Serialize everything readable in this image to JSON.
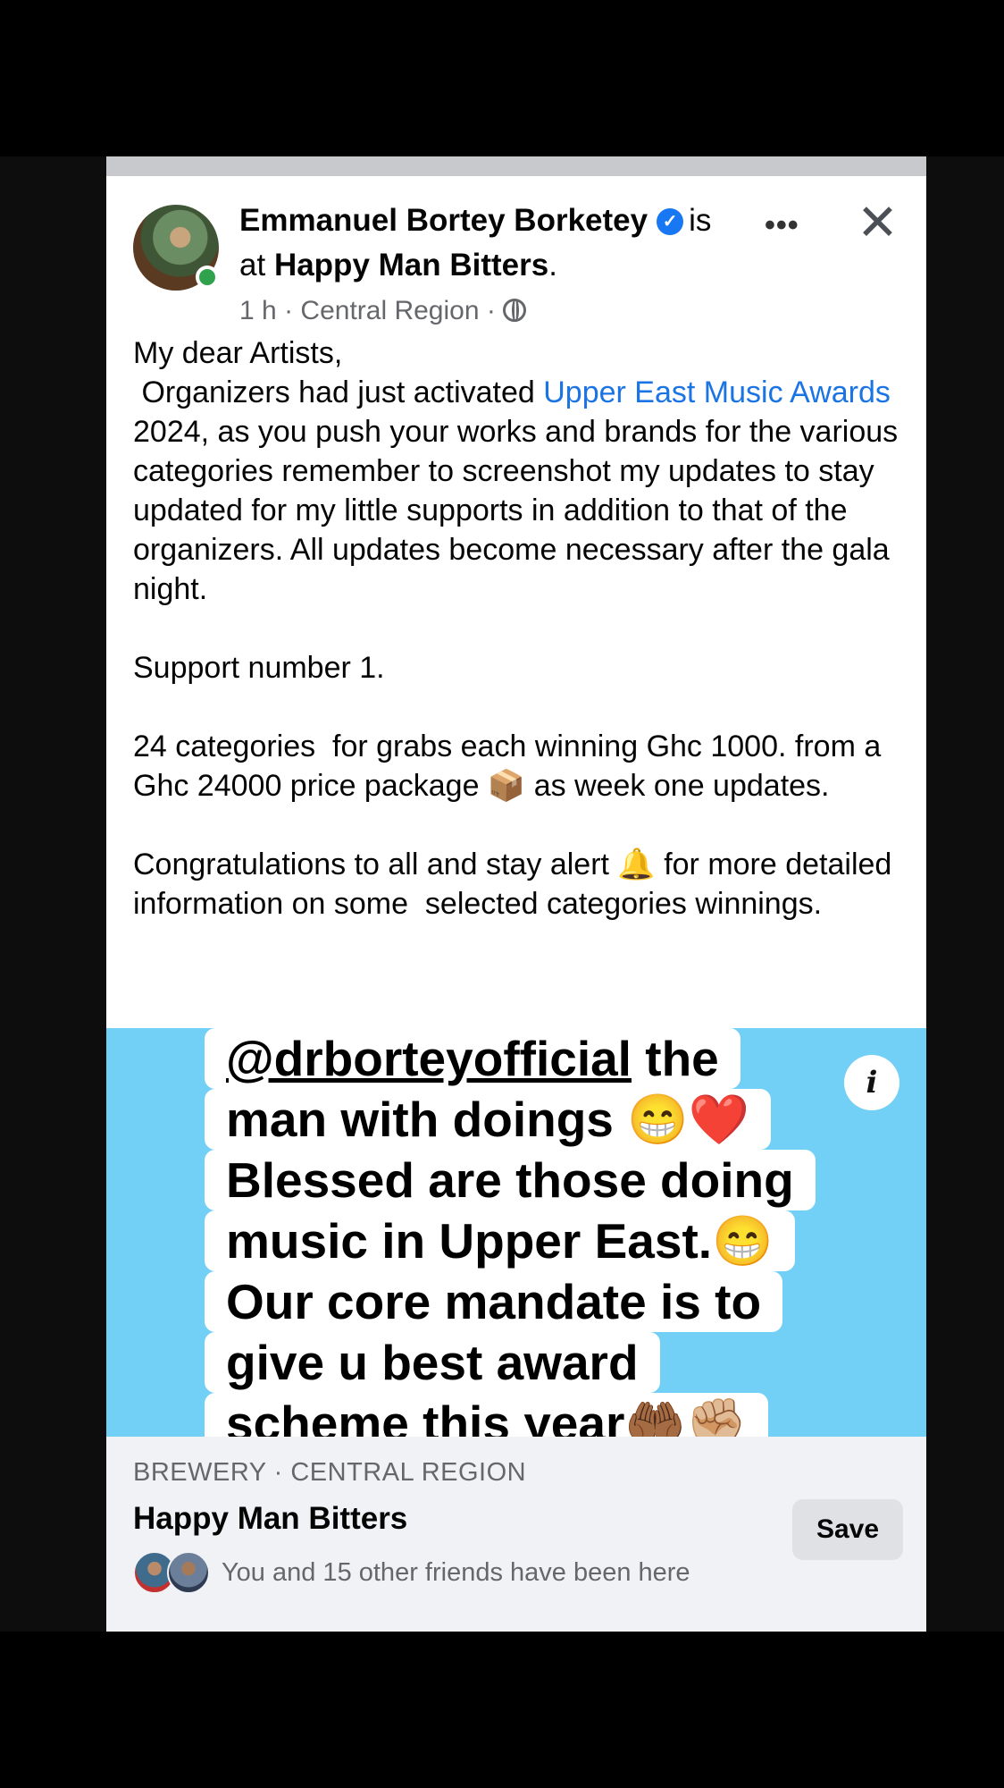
{
  "post": {
    "author": "Emmanuel Bortey Borketey",
    "is_text": "is",
    "at_text": "at",
    "place": "Happy Man Bitters",
    "place_suffix": ".",
    "time": "1 h",
    "separator": "·",
    "location": "Central Region",
    "verified_icon": "verified-badge-icon",
    "paragraphs": {
      "p1": "My dear Artists,",
      "p2_start": " Organizers had just activated ",
      "p2_link": "Upper East Music Awards",
      "p2_rest": " 2024, as you push your works and brands for the various categories remember to screenshot my updates to stay updated for my little supports in addition to that of the organizers. All updates become necessary after the gala night.",
      "p3": "Support number 1.",
      "p4": "24 categories  for grabs each winning Ghc 1000. from a Ghc 24000 price package 📦 as week one updates.",
      "p5": "Congratulations to all and stay alert 🔔 for more detailed information on some  selected categories winnings."
    }
  },
  "media": {
    "caption_lines": [
      {
        "mention": "@drborteyofficial",
        "text": " the"
      },
      {
        "text": "man with doings 😁❤️"
      },
      {
        "text": "Blessed are those doing"
      },
      {
        "text": "music in Upper East.😁"
      },
      {
        "text": "Our core mandate is to"
      },
      {
        "text": "give u best award"
      },
      {
        "text": "scheme this year🤲🏾✊🏼"
      }
    ],
    "info_icon_glyph": "i",
    "background_color": "#72cff5"
  },
  "place_card": {
    "category": "BREWERY · CENTRAL REGION",
    "name": "Happy Man Bitters",
    "save_label": "Save",
    "friends_text": "You and 15 other friends have been here"
  },
  "icons": {
    "more": "•••",
    "close": "✕"
  }
}
